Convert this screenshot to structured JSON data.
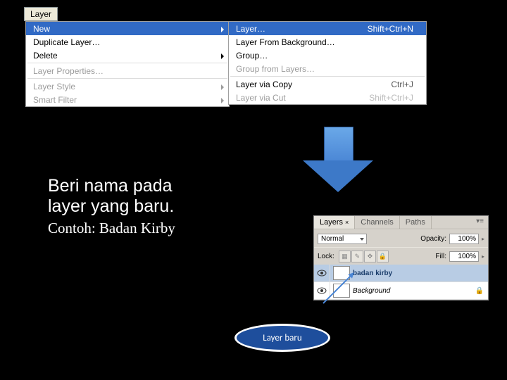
{
  "menubar": {
    "label": "Layer"
  },
  "menu1": {
    "items": [
      {
        "label": "New",
        "hover": true,
        "arrow": true
      },
      {
        "label": "Duplicate Layer…"
      },
      {
        "label": "Delete",
        "arrow": true
      },
      {
        "sep": true
      },
      {
        "label": "Layer Properties…",
        "disabled": true
      },
      {
        "sep": true
      },
      {
        "label": "Layer Style",
        "disabled": true,
        "arrow": true
      },
      {
        "label": "Smart Filter",
        "disabled": true,
        "arrow": true
      }
    ]
  },
  "menu2": {
    "items": [
      {
        "label": "Layer…",
        "shortcut": "Shift+Ctrl+N",
        "hover": true
      },
      {
        "label": "Layer From Background…"
      },
      {
        "label": "Group…"
      },
      {
        "label": "Group from Layers…",
        "disabled": true
      },
      {
        "sep": true
      },
      {
        "label": "Layer via Copy",
        "shortcut": "Ctrl+J"
      },
      {
        "label": "Layer via Cut",
        "shortcut": "Shift+Ctrl+J",
        "disabled": true
      }
    ]
  },
  "instruction": {
    "line1": "Beri nama pada",
    "line2": "layer yang baru.",
    "line3": "Contoh: Badan Kirby"
  },
  "panel": {
    "tabs": [
      {
        "label": "Layers",
        "active": true
      },
      {
        "label": "Channels"
      },
      {
        "label": "Paths"
      }
    ],
    "mode_label": "Normal",
    "opacity_label": "Opacity:",
    "opacity_value": "100%",
    "lock_label": "Lock:",
    "fill_label": "Fill:",
    "fill_value": "100%",
    "layers": [
      {
        "name": "badan kirby",
        "selected": true
      },
      {
        "name": "Background"
      }
    ]
  },
  "callout": {
    "label": "Layer baru"
  }
}
